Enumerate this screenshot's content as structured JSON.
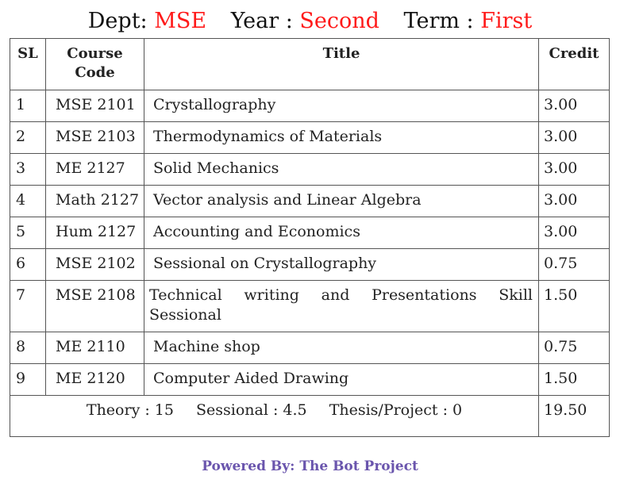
{
  "header": {
    "dept_label": "Dept:",
    "dept_value": "MSE",
    "year_label": "Year :",
    "year_value": "Second",
    "term_label": "Term :",
    "term_value": "First",
    "accent_color": "#ff1a1a"
  },
  "table": {
    "columns": {
      "sl": "SL",
      "code_line1": "Course",
      "code_line2": "Code",
      "title": "Title",
      "credit": "Credit"
    },
    "rows": [
      {
        "sl": "1",
        "code": "MSE 2101",
        "title": "Crystallography",
        "credit": "3.00"
      },
      {
        "sl": "2",
        "code": "MSE 2103",
        "title": "Thermodynamics of Materials",
        "credit": "3.00"
      },
      {
        "sl": "3",
        "code": "ME 2127",
        "title": "Solid Mechanics",
        "credit": "3.00"
      },
      {
        "sl": "4",
        "code": "Math 2127",
        "title": "Vector analysis and Linear Algebra",
        "credit": "3.00"
      },
      {
        "sl": "5",
        "code": "Hum 2127",
        "title": "Accounting and Economics",
        "credit": "3.00"
      },
      {
        "sl": "6",
        "code": "MSE 2102",
        "title": "Sessional on Crystallography",
        "credit": "0.75"
      },
      {
        "sl": "7",
        "code": "MSE 2108",
        "title": "Technical writing and Presentations Skill Sessional",
        "credit": "1.50"
      },
      {
        "sl": "8",
        "code": "ME 2110",
        "title": "Machine shop",
        "credit": "0.75"
      },
      {
        "sl": "9",
        "code": "ME 2120",
        "title": "Computer Aided Drawing",
        "credit": "1.50"
      }
    ],
    "summary": {
      "theory": "Theory : 15",
      "sessional": "Sessional : 4.5",
      "thesis": "Thesis/Project : 0",
      "total_credit": "19.50"
    }
  },
  "footer": {
    "powered_by": "Powered By: The Bot Project",
    "color": "#6a55ad"
  }
}
